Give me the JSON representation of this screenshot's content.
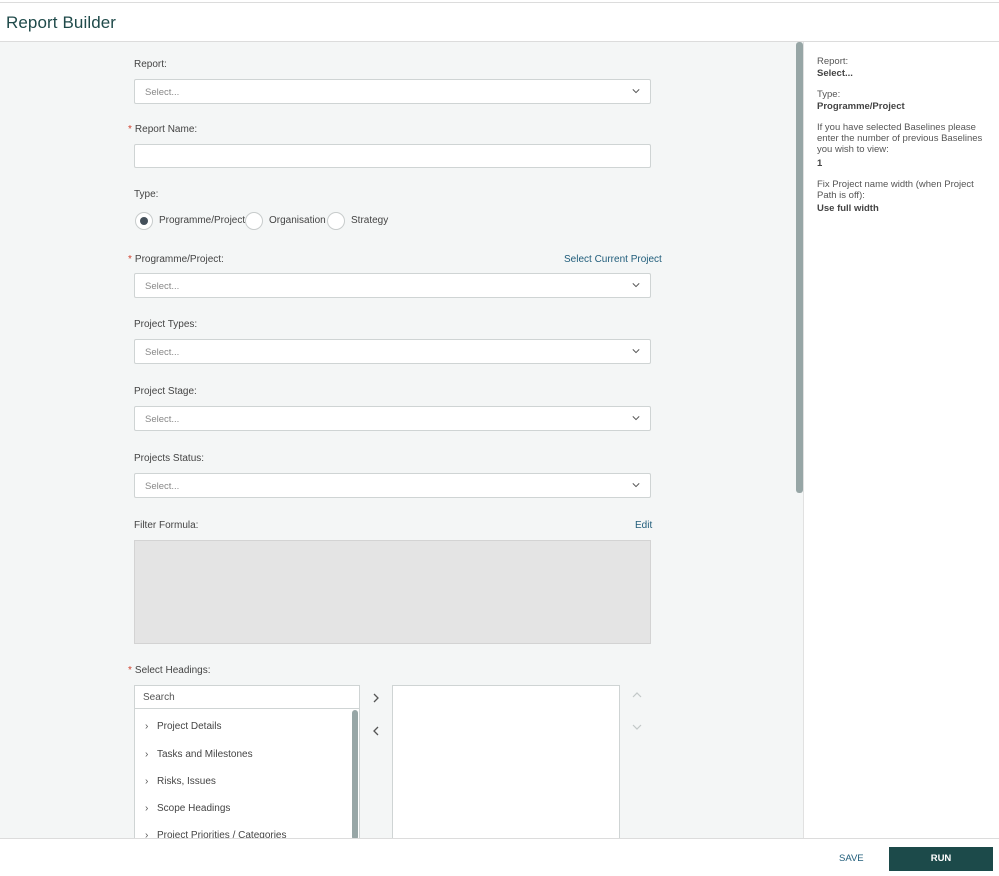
{
  "app": {
    "title": "Report Builder"
  },
  "form": {
    "report": {
      "label": "Report:",
      "placeholder": "Select..."
    },
    "report_name": {
      "label": "Report Name:",
      "value": ""
    },
    "type": {
      "label": "Type:",
      "options": [
        "Programme/Project",
        "Organisation",
        "Strategy"
      ],
      "selected": "Programme/Project"
    },
    "programme_project": {
      "label": "Programme/Project:",
      "placeholder": "Select...",
      "action": "Select Current Project"
    },
    "project_types": {
      "label": "Project Types:",
      "placeholder": "Select..."
    },
    "project_stage": {
      "label": "Project Stage:",
      "placeholder": "Select..."
    },
    "projects_status": {
      "label": "Projects Status:",
      "placeholder": "Select..."
    },
    "filter_formula": {
      "label": "Filter Formula:",
      "action": "Edit"
    },
    "headings": {
      "label": "Select Headings:",
      "search_placeholder": "Search",
      "items": [
        "Project Details",
        "Tasks and Milestones",
        "Risks, Issues",
        "Scope Headings",
        "Project Priorities / Categories"
      ]
    },
    "required_marker": "*"
  },
  "summary": {
    "report_label": "Report:",
    "report_value": "Select...",
    "type_label": "Type:",
    "type_value": "Programme/Project",
    "baselines_text": "If you have selected Baselines please enter the number of previous Baselines you wish to view:",
    "baselines_value": "1",
    "width_text": "Fix Project name width (when Project Path is off):",
    "width_value": "Use full width"
  },
  "footer": {
    "save_label": "SAVE",
    "run_label": "RUN"
  },
  "colors": {
    "primary": "#1c4a4a",
    "link": "#1f5c7a",
    "required": "#d0412e",
    "scroll": "#97a6a6"
  },
  "icons": [
    "chevron-down-icon",
    "chevron-right-icon",
    "chevron-left-icon",
    "chevron-up-icon"
  ]
}
